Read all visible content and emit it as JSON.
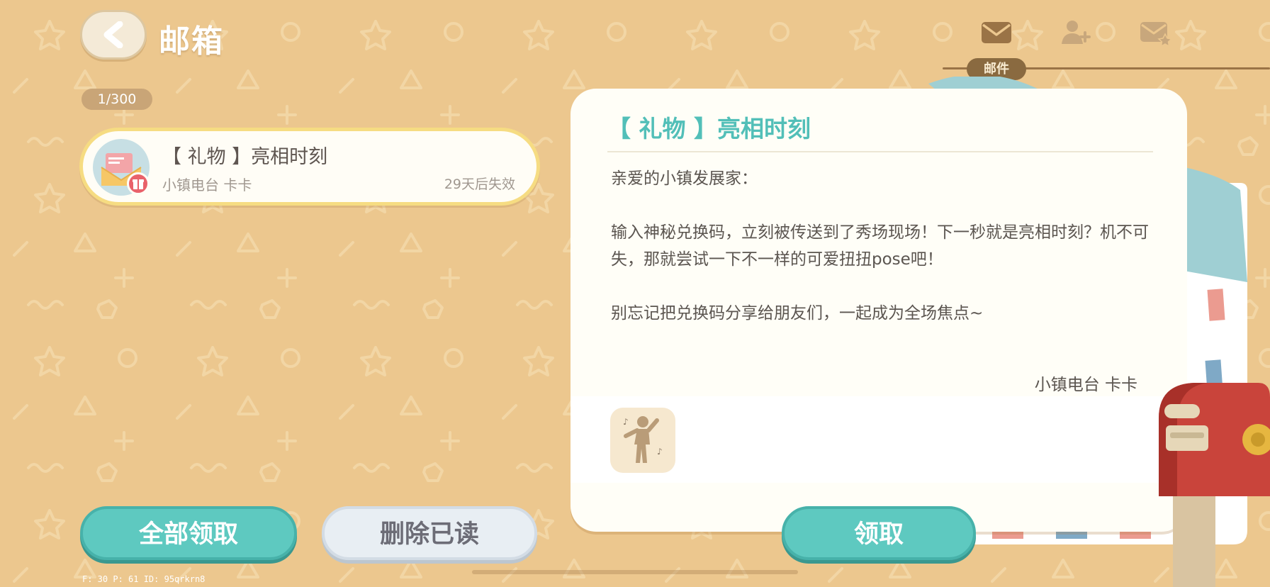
{
  "header": {
    "title": "邮箱",
    "tab_label": "邮件",
    "icons": [
      "mail-icon",
      "add-friend-icon",
      "favorite-mail-icon"
    ]
  },
  "list": {
    "count": "1/300",
    "items": [
      {
        "subject": "【 礼物 】亮相时刻",
        "sender": "小镇电台 卡卡",
        "expire": "29天后失效"
      }
    ]
  },
  "detail": {
    "title": "【 礼物 】亮相时刻",
    "greeting": "亲爱的小镇发展家：",
    "paragraph1": "输入神秘兑换码，立刻被传送到了秀场现场！下一秒就是亮相时刻？机不可失，那就尝试一下不一样的可爱扭扭pose吧！",
    "paragraph2": "别忘记把兑换码分享给朋友们，一起成为全场焦点~",
    "signature": "小镇电台 卡卡",
    "attachment_icon": "dance-pose-icon"
  },
  "buttons": {
    "claim_all": "全部领取",
    "delete_read": "删除已读",
    "claim": "领取"
  },
  "debug": "F: 30   P: 61   ID: 95qrkrn8",
  "colors": {
    "background": "#ecc78e",
    "accent_teal": "#5ec9c0",
    "title_teal": "#52bfb8",
    "highlight_border": "#f6dc82"
  }
}
